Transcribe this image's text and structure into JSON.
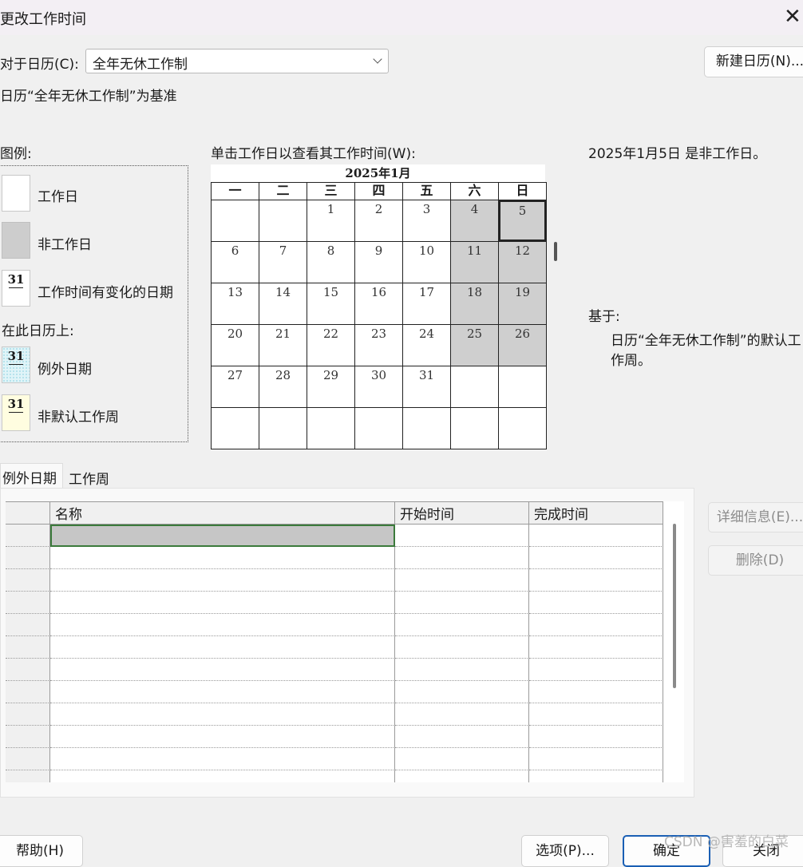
{
  "window": {
    "title": "更改工作时间",
    "close_glyph": "✕"
  },
  "for_calendar": {
    "label": "对于日历(C):",
    "value": "全年无休工作制"
  },
  "new_calendar_button": "新建日历(N)...",
  "base_note": "日历“全年无休工作制”为基准",
  "legend": {
    "title": "图例:",
    "items": [
      {
        "label": "工作日"
      },
      {
        "label": "非工作日"
      },
      {
        "label": "工作时间有变化的日期",
        "num": "31"
      }
    ],
    "on_this_calendar": "在此日历上:",
    "calendar_items": [
      {
        "label": "例外日期",
        "num": "31"
      },
      {
        "label": "非默认工作周",
        "num": "31"
      }
    ]
  },
  "calendar": {
    "instruction": "单击工作日以查看其工作时间(W):",
    "month_title": "2025年1月",
    "weekdays": [
      "一",
      "二",
      "三",
      "四",
      "五",
      "六",
      "日"
    ],
    "weeks": [
      [
        "",
        "",
        "1",
        "2",
        "3",
        "4",
        "5"
      ],
      [
        "6",
        "7",
        "8",
        "9",
        "10",
        "11",
        "12"
      ],
      [
        "13",
        "14",
        "15",
        "16",
        "17",
        "18",
        "19"
      ],
      [
        "20",
        "21",
        "22",
        "23",
        "24",
        "25",
        "26"
      ],
      [
        "27",
        "28",
        "29",
        "30",
        "31",
        "",
        ""
      ],
      [
        "",
        "",
        "",
        "",
        "",
        "",
        ""
      ]
    ],
    "nonworking_cells": [
      "0-5",
      "0-6",
      "1-5",
      "1-6",
      "2-5",
      "2-6",
      "3-5",
      "3-6"
    ],
    "selected_cell": "0-6",
    "colors": {
      "nonworking": "#cfcfcf"
    }
  },
  "info": {
    "status": "2025年1月5日 是非工作日。",
    "based_on_label": "基于:",
    "based_on_text_line1": "日历“全年无休工作制”的默认工",
    "based_on_text_line2": "作周。"
  },
  "tabs": [
    {
      "label": "例外日期"
    },
    {
      "label": "工作周"
    }
  ],
  "exceptions_table": {
    "columns": [
      "名称",
      "开始时间",
      "完成时间"
    ],
    "row_count": 12
  },
  "side_buttons": {
    "details": "详细信息(E)...",
    "delete": "删除(D)"
  },
  "footer": {
    "help": "帮助(H)",
    "options": "选项(P)...",
    "ok": "确定",
    "close": "关闭"
  },
  "watermark": "CSDN @害羞的白菜"
}
